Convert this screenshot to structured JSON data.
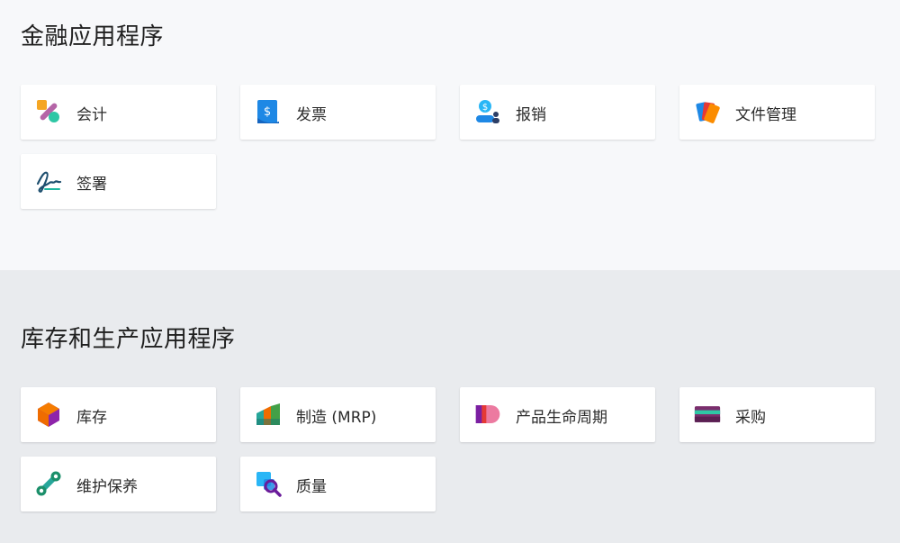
{
  "finance": {
    "title": "金融应用程序",
    "apps": [
      {
        "label": "会计",
        "icon": "accounting-icon"
      },
      {
        "label": "发票",
        "icon": "invoice-icon"
      },
      {
        "label": "报销",
        "icon": "expense-icon"
      },
      {
        "label": "文件管理",
        "icon": "documents-icon"
      },
      {
        "label": "签署",
        "icon": "signature-icon"
      }
    ]
  },
  "inventory": {
    "title": "库存和生产应用程序",
    "apps": [
      {
        "label": "库存",
        "icon": "inventory-icon"
      },
      {
        "label": "制造 (MRP)",
        "icon": "manufacturing-icon"
      },
      {
        "label": "产品生命周期",
        "icon": "plm-icon"
      },
      {
        "label": "采购",
        "icon": "purchase-icon"
      },
      {
        "label": "维护保养",
        "icon": "maintenance-icon"
      },
      {
        "label": "质量",
        "icon": "quality-icon"
      }
    ]
  },
  "colors": {
    "finance_background": "#f7f8fa",
    "inventory_background": "#e9ebee",
    "card_background": "#ffffff"
  }
}
